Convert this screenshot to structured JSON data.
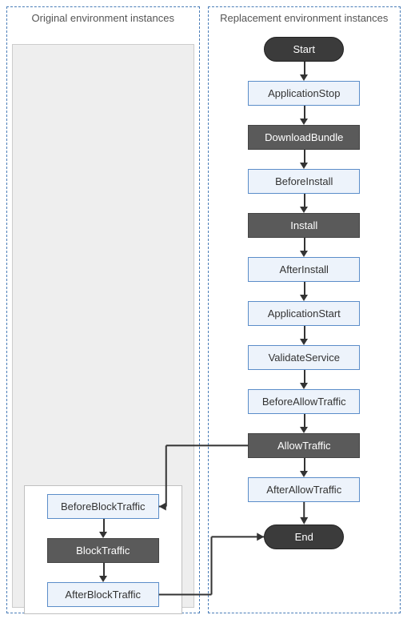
{
  "columns": {
    "left": {
      "title": "Original environment instances"
    },
    "right": {
      "title": "Replacement environment instances"
    }
  },
  "terminals": {
    "start": "Start",
    "end": "End"
  },
  "right_nodes": [
    {
      "label": "ApplicationStop",
      "kind": "light"
    },
    {
      "label": "DownloadBundle",
      "kind": "dark"
    },
    {
      "label": "BeforeInstall",
      "kind": "light"
    },
    {
      "label": "Install",
      "kind": "dark"
    },
    {
      "label": "AfterInstall",
      "kind": "light"
    },
    {
      "label": "ApplicationStart",
      "kind": "light"
    },
    {
      "label": "ValidateService",
      "kind": "light"
    },
    {
      "label": "BeforeAllowTraffic",
      "kind": "light"
    },
    {
      "label": "AllowTraffic",
      "kind": "dark"
    },
    {
      "label": "AfterAllowTraffic",
      "kind": "light"
    }
  ],
  "left_nodes": [
    {
      "label": "BeforeBlockTraffic",
      "kind": "light"
    },
    {
      "label": "BlockTraffic",
      "kind": "dark"
    },
    {
      "label": "AfterBlockTraffic",
      "kind": "light"
    }
  ]
}
